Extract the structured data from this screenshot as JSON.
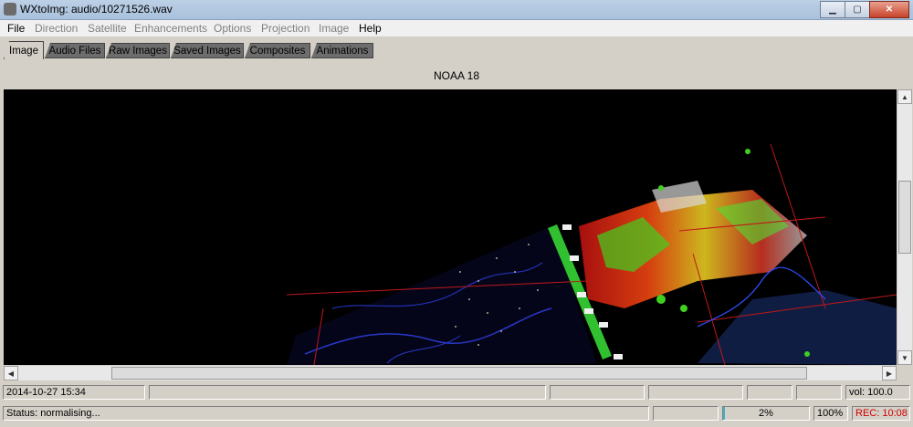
{
  "window": {
    "title": "WXtoImg: audio/10271526.wav"
  },
  "menu": [
    {
      "label": "File",
      "enabled": true
    },
    {
      "label": "Direction",
      "enabled": false
    },
    {
      "label": "Satellite",
      "enabled": false
    },
    {
      "label": "Enhancements",
      "enabled": false
    },
    {
      "label": "Options",
      "enabled": false
    },
    {
      "label": "Projection",
      "enabled": false
    },
    {
      "label": "Image",
      "enabled": false
    },
    {
      "label": "Help",
      "enabled": true
    }
  ],
  "tabs": [
    "Image",
    "Audio Files",
    "Raw Images",
    "Saved Images",
    "Composites",
    "Animations"
  ],
  "selected_tab": "Image",
  "satellite": "NOAA 18",
  "status": {
    "datetime": "2014-10-27  15:34",
    "vol": "vol: 100.0",
    "message": "Status: normalising...",
    "progress_label": "2%",
    "progress_value": 0.02,
    "zoom": "100%",
    "rec": "REC: 10:08"
  },
  "colors": {
    "accent": "#35b6c8",
    "rec": "#d00000"
  }
}
